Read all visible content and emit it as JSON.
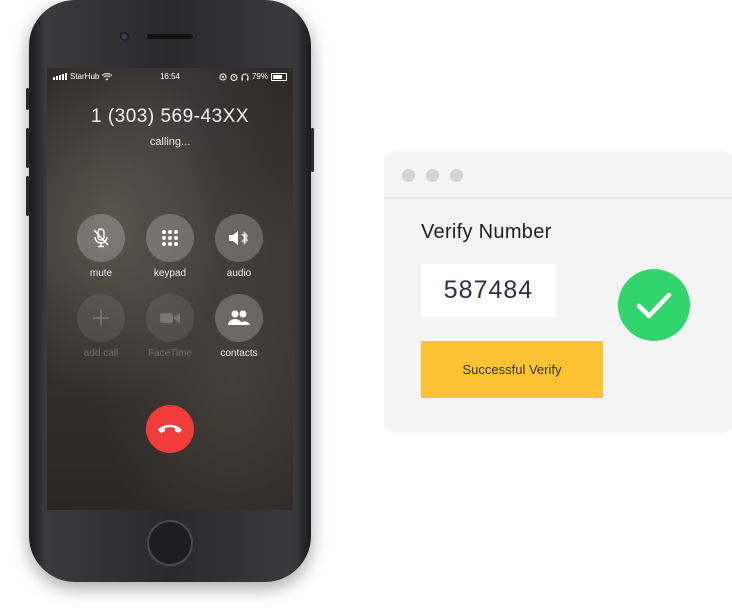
{
  "phone": {
    "status": {
      "carrier": "StarHub",
      "time": "16:54",
      "battery": "79%"
    },
    "caller_number": "1 (303) 569-43XX",
    "call_status": "calling...",
    "controls": [
      {
        "label": "mute",
        "icon": "mic-off-icon",
        "enabled": true
      },
      {
        "label": "keypad",
        "icon": "keypad-icon",
        "enabled": true
      },
      {
        "label": "audio",
        "icon": "speaker-bluetooth-icon",
        "enabled": true
      },
      {
        "label": "add call",
        "icon": "plus-icon",
        "enabled": false
      },
      {
        "label": "FaceTime",
        "icon": "video-camera-icon",
        "enabled": false
      },
      {
        "label": "contacts",
        "icon": "contacts-icon",
        "enabled": true
      }
    ],
    "end_call_icon": "phone-hangup-icon"
  },
  "verify_window": {
    "title": "Verify Number",
    "code": "587484",
    "button_label": "Successful Verify",
    "success_icon": "checkmark-icon"
  },
  "colors": {
    "accent_yellow": "#fbc232",
    "success_green": "#32d46e",
    "end_call_red": "#f23c3c",
    "window_bg": "#f4f4f4"
  }
}
